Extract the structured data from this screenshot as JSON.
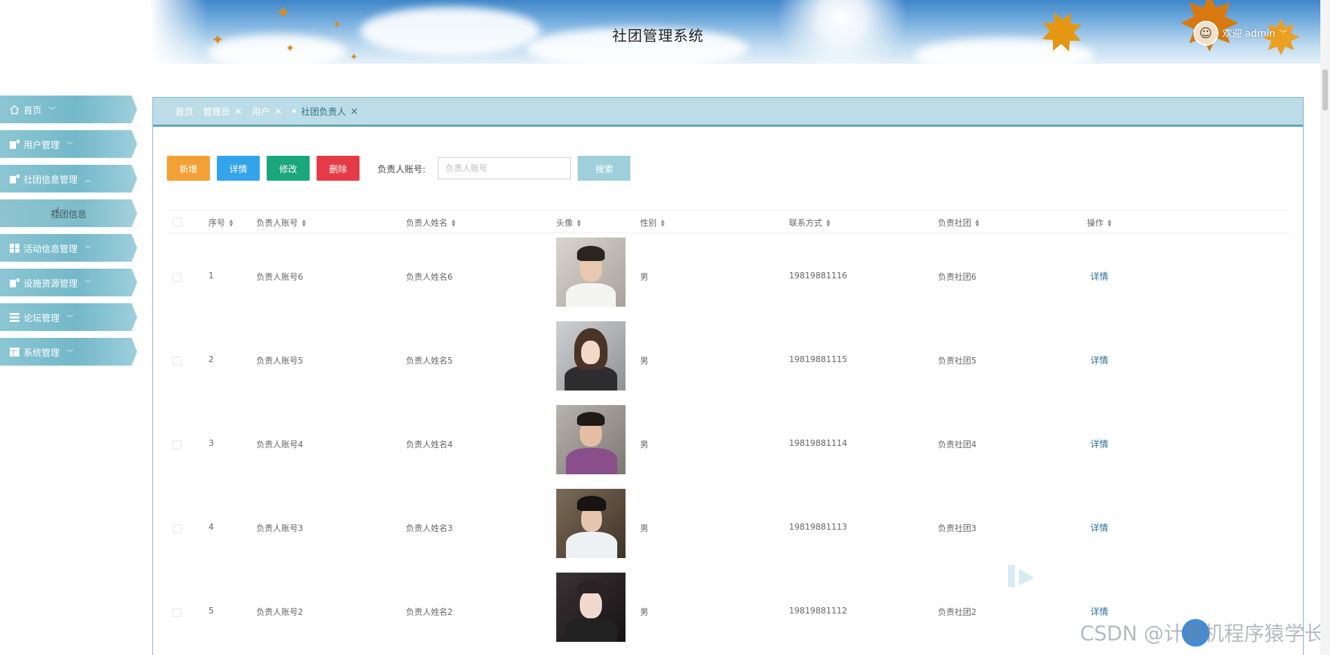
{
  "header": {
    "title": "社团管理系统",
    "welcome": "欢迎 admin",
    "dropdown_icon": "chevron-down-icon"
  },
  "sidebar": {
    "items": [
      {
        "label": "首页",
        "icon": "home-icon"
      },
      {
        "label": "用户管理",
        "icon": "user-icon"
      },
      {
        "label": "社团信息管理",
        "icon": "doc-icon",
        "expanded": true,
        "children": [
          "社团信息"
        ]
      },
      {
        "label": "活动信息管理",
        "icon": "grid-icon"
      },
      {
        "label": "设施资源管理",
        "icon": "doc-icon"
      },
      {
        "label": "论坛管理",
        "icon": "list-icon"
      },
      {
        "label": "系统管理",
        "icon": "table-icon"
      }
    ]
  },
  "tabs": [
    {
      "label": "首页",
      "closable": false
    },
    {
      "label": "管理员",
      "closable": true
    },
    {
      "label": "用户",
      "closable": true
    },
    {
      "label": "社团负责人",
      "closable": true,
      "active": true
    }
  ],
  "toolbar": {
    "add": "新增",
    "detail": "详情",
    "edit": "修改",
    "delete": "删除",
    "search_label": "负责人账号:",
    "search_placeholder": "负责人账号",
    "search_button": "搜索"
  },
  "table": {
    "columns": [
      "序号",
      "负责人账号",
      "负责人姓名",
      "头像",
      "性别",
      "联系方式",
      "负责社团",
      "操作"
    ],
    "action_label": "详情",
    "rows": [
      {
        "no": "1",
        "account": "负责人账号6",
        "name": "负责人姓名6",
        "gender": "男",
        "phone": "19819881116",
        "club": "负责社团6"
      },
      {
        "no": "2",
        "account": "负责人账号5",
        "name": "负责人姓名5",
        "gender": "男",
        "phone": "19819881115",
        "club": "负责社团5"
      },
      {
        "no": "3",
        "account": "负责人账号4",
        "name": "负责人姓名4",
        "gender": "男",
        "phone": "19819881114",
        "club": "负责社团4"
      },
      {
        "no": "4",
        "account": "负责人账号3",
        "name": "负责人姓名3",
        "gender": "男",
        "phone": "19819881113",
        "club": "负责社团3"
      },
      {
        "no": "5",
        "account": "负责人账号2",
        "name": "负责人姓名2",
        "gender": "男",
        "phone": "19819881112",
        "club": "负责社团2"
      }
    ]
  },
  "watermark": "CSDN @计算机程序猿学长",
  "colors": {
    "sidebar": "#7fbccb",
    "tab_bar": "#bcdde7",
    "add": "#f3a035",
    "detail": "#34a4ea",
    "edit": "#1aa77a",
    "delete": "#e63b46",
    "search": "#9ecfdb",
    "link": "#2d6f9a"
  }
}
